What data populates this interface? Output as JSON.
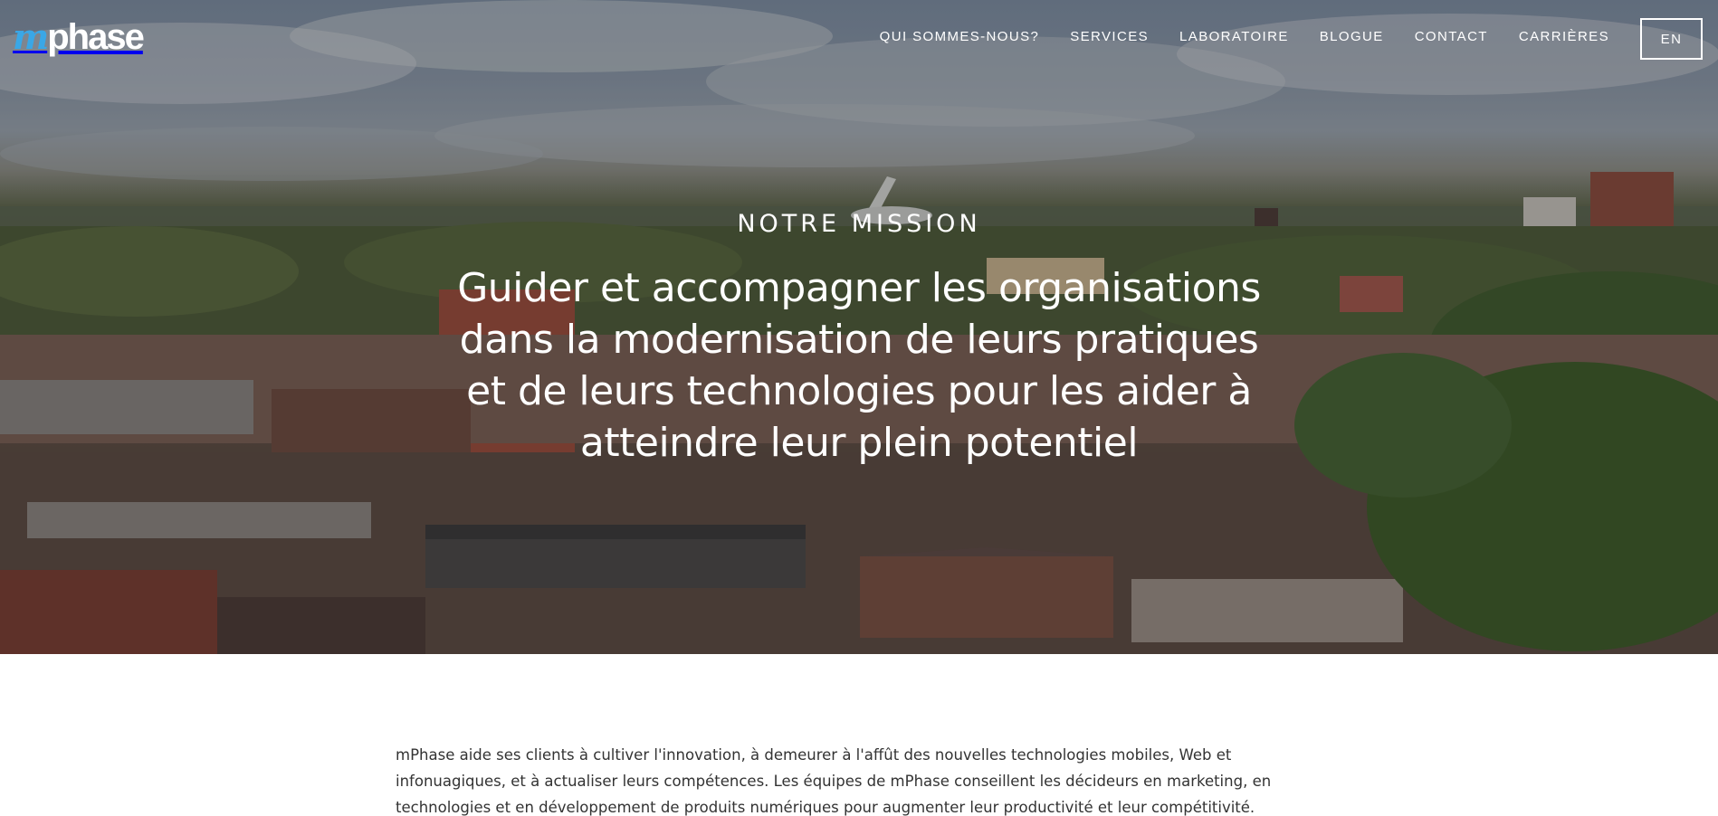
{
  "brand": {
    "logo_m": "m",
    "logo_rest": "phase",
    "accent_color": "#3aa7e6"
  },
  "nav": {
    "items": [
      {
        "label": "QUI SOMMES-NOUS?"
      },
      {
        "label": "SERVICES"
      },
      {
        "label": "LABORATOIRE"
      },
      {
        "label": "BLOGUE"
      },
      {
        "label": "CONTACT"
      },
      {
        "label": "CARRIÈRES"
      }
    ],
    "language_toggle": "EN"
  },
  "hero": {
    "eyebrow": "NOTRE MISSION",
    "mission": "Guider et accompagner les organisations dans la modernisation de leurs pratiques et de leurs technologies pour les aider à atteindre leur plein potentiel"
  },
  "intro": {
    "paragraph": "mPhase aide ses clients à cultiver l'innovation, à demeurer à l'affût des nouvelles technologies mobiles, Web et infonuagiques, et à actualiser leurs compétences. Les équipes de mPhase conseillent les décideurs en marketing, en technologies et en développement de produits numériques pour augmenter leur productivité et leur compétitivité."
  }
}
